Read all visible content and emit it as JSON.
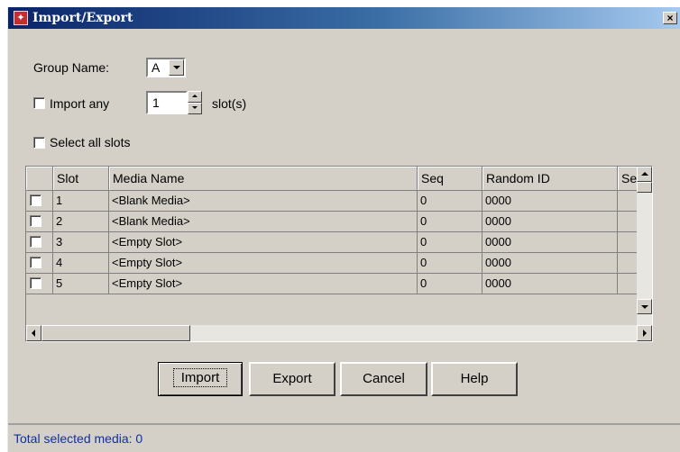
{
  "window": {
    "title": "Import/Export",
    "close_label": "×"
  },
  "form": {
    "group_name_label": "Group Name:",
    "group_name_value": "A",
    "import_any_label": "Import any",
    "import_any_checked": false,
    "import_count": "1",
    "slots_suffix": "slot(s)",
    "select_all_label": "Select all slots",
    "select_all_checked": false
  },
  "table": {
    "columns": [
      "",
      "Slot",
      "Media Name",
      "Seq",
      "Random ID",
      "Seria"
    ],
    "rows": [
      {
        "checked": false,
        "slot": "1",
        "media": "<Blank Media>",
        "seq": "0",
        "random_id": "0000",
        "serial": ""
      },
      {
        "checked": false,
        "slot": "2",
        "media": "<Blank Media>",
        "seq": "0",
        "random_id": "0000",
        "serial": ""
      },
      {
        "checked": false,
        "slot": "3",
        "media": "<Empty Slot>",
        "seq": "0",
        "random_id": "0000",
        "serial": ""
      },
      {
        "checked": false,
        "slot": "4",
        "media": "<Empty Slot>",
        "seq": "0",
        "random_id": "0000",
        "serial": ""
      },
      {
        "checked": false,
        "slot": "5",
        "media": "<Empty Slot>",
        "seq": "0",
        "random_id": "0000",
        "serial": ""
      }
    ]
  },
  "buttons": {
    "import": "Import",
    "export": "Export",
    "cancel": "Cancel",
    "help": "Help"
  },
  "status": {
    "text": "Total selected media: 0"
  }
}
